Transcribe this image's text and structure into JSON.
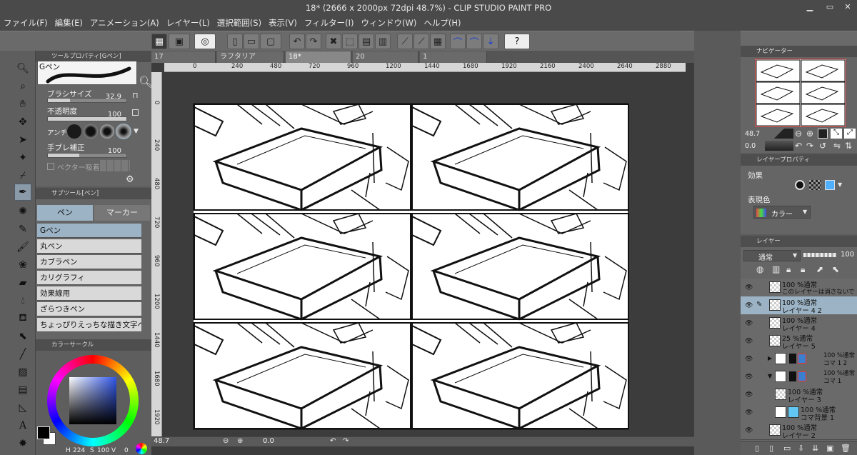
{
  "window": {
    "title": "18* (2666 x 2000px 72dpi 48.7%) - CLIP STUDIO PAINT PRO"
  },
  "menu": [
    "ファイル(F)",
    "編集(E)",
    "アニメーション(A)",
    "レイヤー(L)",
    "選択範囲(S)",
    "表示(V)",
    "フィルター(I)",
    "ウィンドウ(W)",
    "ヘルプ(H)"
  ],
  "help_icon": "?",
  "tool_property": {
    "header": "ツールプロパティ[Gペン]",
    "brush_name": "Gペン",
    "brush_size_label": "ブラシサイズ",
    "brush_size_value": "32.9",
    "opacity_label": "不透明度",
    "opacity_value": "100",
    "antialias_label": "アンチ",
    "stabilization_label": "手ブレ補正",
    "stabilization_value": "100",
    "vector_snap_label": "ベクター吸着"
  },
  "sub_tool": {
    "header": "サブツール[ペン]",
    "tabs": [
      "ペン",
      "マーカー"
    ],
    "items": [
      "Gペン",
      "丸ペン",
      "カブラペン",
      "カリグラフィ",
      "効果線用",
      "ざらつきペン",
      "ちょっぴりえっちな描き文字ペン"
    ],
    "selected_index": 0
  },
  "color_circle": {
    "header": "カラーサークル",
    "h_label": "H",
    "h_value": "224",
    "s_label": "S",
    "s_value": "100",
    "v_label": "V",
    "v_value": "0"
  },
  "canvas_tabs": [
    {
      "label": "17",
      "active": false
    },
    {
      "label": "ラフタリア",
      "active": false
    },
    {
      "label": "18*",
      "active": true
    },
    {
      "label": "20",
      "active": false
    },
    {
      "label": "1",
      "active": false
    }
  ],
  "ruler_h": [
    "0",
    "240",
    "480",
    "720",
    "960",
    "1200",
    "1440",
    "1680",
    "1920",
    "2160",
    "2400",
    "2640",
    "2880"
  ],
  "ruler_v": [
    "0",
    "240",
    "480",
    "720",
    "960",
    "1200",
    "1440",
    "1680",
    "1920"
  ],
  "status": {
    "zoom": "48.7",
    "angle": "0.0"
  },
  "navigator": {
    "header": "ナビゲーター",
    "zoom": "48.7",
    "angle": "0.0"
  },
  "layer_property": {
    "header": "レイヤープロパティ",
    "effect_label": "効果",
    "expression_label": "表現色",
    "expression_value": "カラー"
  },
  "layers_panel": {
    "header": "レイヤー",
    "blend_mode": "通常",
    "opacity": "100",
    "layers": [
      {
        "line1": "100 %通常",
        "line2": "このレイヤーは消さないで",
        "selected": false
      },
      {
        "line1": "100 %通常",
        "line2": "レイヤー 4 2",
        "selected": true
      },
      {
        "line1": "100 %通常",
        "line2": "レイヤー 4",
        "selected": false
      },
      {
        "line1": "25 %通常",
        "line2": "レイヤー 5",
        "selected": false
      },
      {
        "line1": "100 %通常",
        "line2": "コマ 1 2",
        "selected": false
      },
      {
        "line1": "100 %通常",
        "line2": "コマ 1",
        "selected": false
      },
      {
        "line1": "100 %通常",
        "line2": "レイヤー 3",
        "selected": false
      },
      {
        "line1": "100 %通常",
        "line2": "コマ背景 1",
        "selected": false
      },
      {
        "line1": "100 %通常",
        "line2": "レイヤー 2",
        "selected": false
      }
    ]
  },
  "colors": {
    "accent_selection": "#9bb3c4",
    "main_color": "#000000",
    "sub_color": "#ffffff"
  }
}
